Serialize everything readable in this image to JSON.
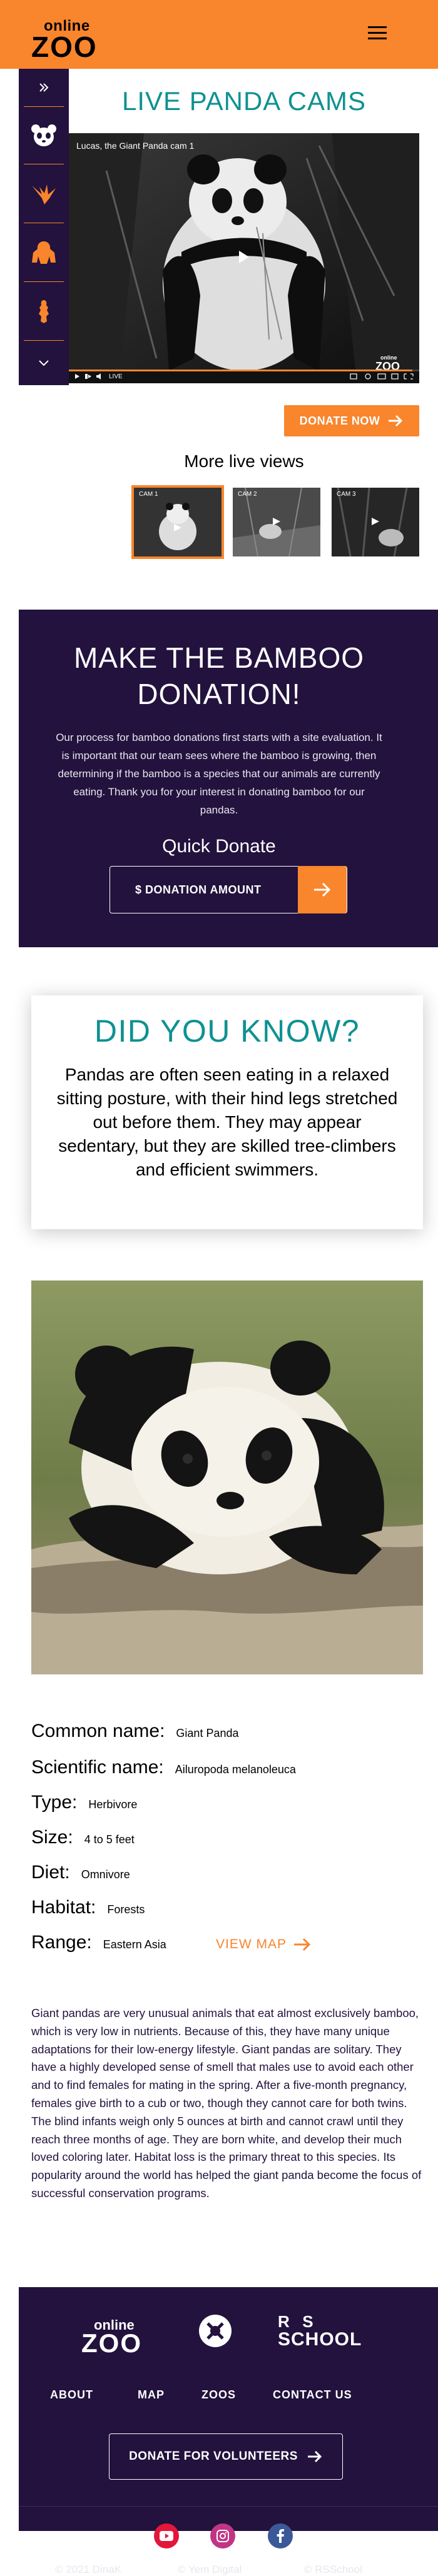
{
  "header": {
    "logo_top": "online",
    "logo_main": "ZOO",
    "menu_icon": "hamburger-icon",
    "bg_color": "#F9852D"
  },
  "sidebar": {
    "items": [
      {
        "icon": "chevrons-right-icon"
      },
      {
        "icon": "panda-icon"
      },
      {
        "icon": "eagle-icon"
      },
      {
        "icon": "gorilla-icon"
      },
      {
        "icon": "alligator-icon"
      },
      {
        "icon": "chevron-down-icon"
      }
    ]
  },
  "live": {
    "title": "LIVE PANDA CAMS",
    "video_caption": "Lucas, the Giant Panda cam 1",
    "live_label": "LIVE",
    "donate_button": "DONATE NOW",
    "more_title": "More live views",
    "thumbs": [
      {
        "label": "CAM 1"
      },
      {
        "label": "CAM 2"
      },
      {
        "label": "CAM 3"
      }
    ]
  },
  "bamboo": {
    "title_line1": "MAKE THE BAMBOO",
    "title_line2": "DONATION!",
    "text": "Our process for bamboo donations first starts with a site evaluation. It is important that our team sees where the bamboo is growing, then determining if the bamboo is a species that our animals are currently eating. Thank you for your interest in donating bamboo for our pandas.",
    "quick_title": "Quick Donate",
    "amount_placeholder": "$ DONATION AMOUNT"
  },
  "did_you_know": {
    "title": "DID YOU KNOW?",
    "text": "Pandas are often seen eating in a relaxed sitting posture, with their hind legs stretched out before them. They may appear sedentary, but they are skilled tree-climbers and efficient swimmers."
  },
  "facts": [
    {
      "key": "Common name:",
      "value": "Giant Panda"
    },
    {
      "key": "Scientific name:",
      "value": "Ailuropoda melanoleuca"
    },
    {
      "key": "Type:",
      "value": "Herbivore"
    },
    {
      "key": "Size:",
      "value": "4 to 5 feet"
    },
    {
      "key": "Diet:",
      "value": "Omnivore"
    },
    {
      "key": "Habitat:",
      "value": "Forests"
    },
    {
      "key": "Range:",
      "value": "Eastern Asia"
    }
  ],
  "view_map": "VIEW MAP",
  "description": "Giant pandas are very unusual animals that eat almost exclusively bamboo, which is very low in nutrients. Because of this, they have many unique adaptations for their low-energy lifestyle. Giant pandas are solitary. They have a highly developed sense of smell that males use to avoid each other and to find females for mating in the spring. After a five-month pregnancy, females give birth to a cub or two, though they cannot care for both twins. The blind infants weigh only 5 ounces at birth and cannot crawl until they reach three months of age. They are born white, and develop their much loved coloring later. Habitat loss is the primary threat to this species. Its popularity around the world has helped the giant panda become the focus of successful conservation programs.",
  "footer": {
    "logo_top": "online",
    "logo_main": "ZOO",
    "rsschool_line1": "R  S",
    "rsschool_line2": "SCHOOL",
    "nav": [
      "ABOUT",
      "MAP",
      "ZOOS",
      "CONTACT US"
    ],
    "donate_button": "DONATE FOR VOLUNTEERS",
    "social": [
      "youtube-icon",
      "instagram-icon",
      "facebook-icon"
    ],
    "copyright": [
      "© 2021 DinaK",
      "© Yem Digital",
      "© RSSchool"
    ]
  },
  "colors": {
    "accent": "#F9852D",
    "dark": "#22123D",
    "teal": "#0F9191"
  }
}
